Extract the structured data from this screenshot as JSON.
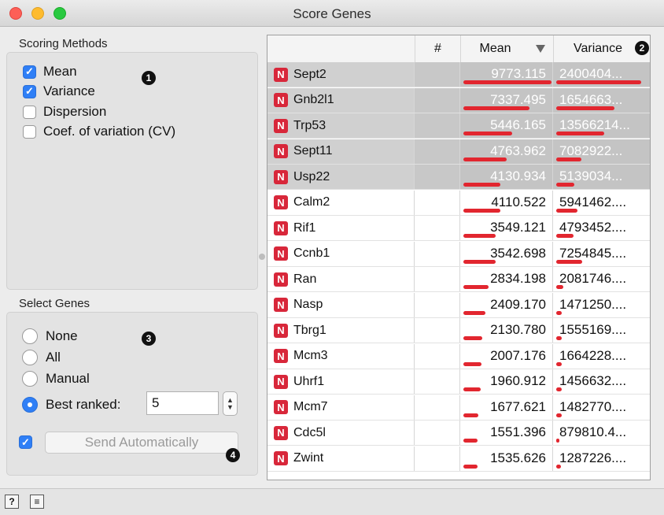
{
  "window": {
    "title": "Score Genes"
  },
  "scoring": {
    "label": "Scoring Methods",
    "badge": "1",
    "methods": [
      {
        "label": "Mean",
        "checked": true
      },
      {
        "label": "Variance",
        "checked": true
      },
      {
        "label": "Dispersion",
        "checked": false
      },
      {
        "label": "Coef. of variation (CV)",
        "checked": false
      }
    ]
  },
  "select_genes": {
    "label": "Select Genes",
    "badge": "3",
    "options": [
      {
        "label": "None",
        "selected": false
      },
      {
        "label": "All",
        "selected": false
      },
      {
        "label": "Manual",
        "selected": false
      },
      {
        "label": "Best ranked:",
        "selected": true
      }
    ],
    "best_ranked_value": "5",
    "auto_send_checked": true,
    "send_label": "Send Automatically",
    "send_badge": "4"
  },
  "table": {
    "columns": {
      "index": "#",
      "mean": "Mean",
      "variance": "Variance"
    },
    "variance_badge": "2",
    "gene_icon_letter": "N",
    "accent_color": "#e2262f",
    "rows": [
      {
        "gene": "Sept2",
        "mean": "9773.115",
        "variance": "2400404...",
        "mean_v": 9773.115,
        "var_v": 24004040,
        "selected": true
      },
      {
        "gene": "Gnb2l1",
        "mean": "7337.495",
        "variance": "1654663...",
        "mean_v": 7337.495,
        "var_v": 16546630,
        "selected": true
      },
      {
        "gene": "Trp53",
        "mean": "5446.165",
        "variance": "13566214...",
        "mean_v": 5446.165,
        "var_v": 13566214,
        "selected": true
      },
      {
        "gene": "Sept11",
        "mean": "4763.962",
        "variance": "7082922...",
        "mean_v": 4763.962,
        "var_v": 7082922,
        "selected": true
      },
      {
        "gene": "Usp22",
        "mean": "4130.934",
        "variance": "5139034...",
        "mean_v": 4130.934,
        "var_v": 5139034,
        "selected": true
      },
      {
        "gene": "Calm2",
        "mean": "4110.522",
        "variance": "5941462....",
        "mean_v": 4110.522,
        "var_v": 5941462,
        "selected": false
      },
      {
        "gene": "Rif1",
        "mean": "3549.121",
        "variance": "4793452....",
        "mean_v": 3549.121,
        "var_v": 4793452,
        "selected": false
      },
      {
        "gene": "Ccnb1",
        "mean": "3542.698",
        "variance": "7254845....",
        "mean_v": 3542.698,
        "var_v": 7254845,
        "selected": false
      },
      {
        "gene": "Ran",
        "mean": "2834.198",
        "variance": "2081746....",
        "mean_v": 2834.198,
        "var_v": 2081746,
        "selected": false
      },
      {
        "gene": "Nasp",
        "mean": "2409.170",
        "variance": "1471250....",
        "mean_v": 2409.17,
        "var_v": 1471250,
        "selected": false
      },
      {
        "gene": "Tbrg1",
        "mean": "2130.780",
        "variance": "1555169....",
        "mean_v": 2130.78,
        "var_v": 1555169,
        "selected": false
      },
      {
        "gene": "Mcm3",
        "mean": "2007.176",
        "variance": "1664228....",
        "mean_v": 2007.176,
        "var_v": 1664228,
        "selected": false
      },
      {
        "gene": "Uhrf1",
        "mean": "1960.912",
        "variance": "1456632....",
        "mean_v": 1960.912,
        "var_v": 1456632,
        "selected": false
      },
      {
        "gene": "Mcm7",
        "mean": "1677.621",
        "variance": "1482770....",
        "mean_v": 1677.621,
        "var_v": 1482770,
        "selected": false
      },
      {
        "gene": "Cdc5l",
        "mean": "1551.396",
        "variance": "879810.4...",
        "mean_v": 1551.396,
        "var_v": 879810.4,
        "selected": false
      },
      {
        "gene": "Zwint",
        "mean": "1535.626",
        "variance": "1287226....",
        "mean_v": 1535.626,
        "var_v": 1287226,
        "selected": false
      }
    ]
  },
  "statusbar": {
    "help_glyph": "?",
    "report_glyph": "≡"
  }
}
